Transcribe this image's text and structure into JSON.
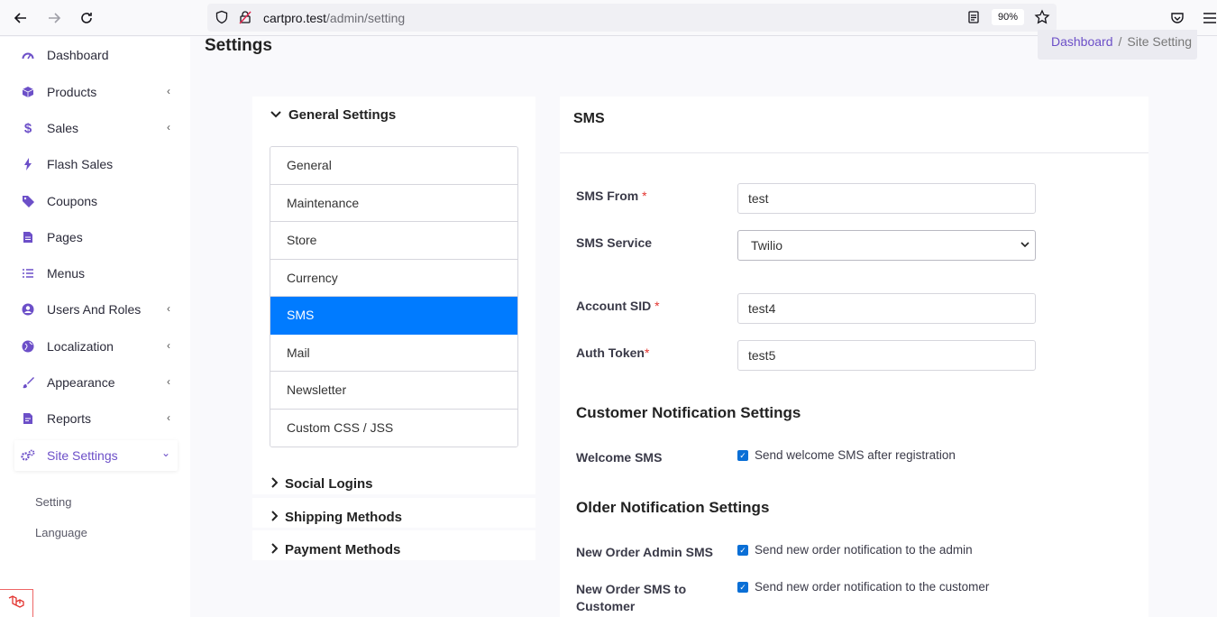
{
  "browser": {
    "url_host": "cartpro.test",
    "url_path": "/admin/setting",
    "zoom": "90%"
  },
  "sidebar": {
    "items": [
      {
        "label": "Dashboard",
        "icon": "dashboard-gauge-icon",
        "chevron": ""
      },
      {
        "label": "Products",
        "icon": "box-icon",
        "chevron": "‹"
      },
      {
        "label": "Sales",
        "icon": "dollar-icon",
        "chevron": "‹"
      },
      {
        "label": "Flash Sales",
        "icon": "bolt-icon",
        "chevron": ""
      },
      {
        "label": "Coupons",
        "icon": "tags-icon",
        "chevron": ""
      },
      {
        "label": "Pages",
        "icon": "file-icon",
        "chevron": ""
      },
      {
        "label": "Menus",
        "icon": "list-icon",
        "chevron": ""
      },
      {
        "label": "Users And Roles",
        "icon": "user-circle-icon",
        "chevron": "‹"
      },
      {
        "label": "Localization",
        "icon": "globe-icon",
        "chevron": "‹"
      },
      {
        "label": "Appearance",
        "icon": "brush-icon",
        "chevron": "‹"
      },
      {
        "label": "Reports",
        "icon": "report-icon",
        "chevron": "‹"
      },
      {
        "label": "Site Settings",
        "icon": "cogs-icon",
        "chevron": "⌄"
      }
    ],
    "submenu": [
      "Setting",
      "Language"
    ]
  },
  "page": {
    "title": "Settings",
    "breadcrumb": {
      "link": "Dashboard",
      "separator": "/",
      "current": "Site Setting"
    }
  },
  "settings_nav": {
    "general_heading": "General Settings",
    "items": [
      "General",
      "Maintenance",
      "Store",
      "Currency",
      "SMS",
      "Mail",
      "Newsletter",
      "Custom CSS / JSS"
    ],
    "active_item": "SMS",
    "collapsed_sections": [
      "Social Logins",
      "Shipping Methods",
      "Payment Methods"
    ]
  },
  "sms_form": {
    "title": "SMS",
    "sms_from": {
      "label": "SMS From",
      "required": "*",
      "value": "test"
    },
    "sms_service": {
      "label": "SMS Service",
      "value": "Twilio"
    },
    "account_sid": {
      "label": "Account SID",
      "required": "*",
      "value": "test4"
    },
    "auth_token": {
      "label": "Auth Token",
      "required": "*",
      "value": "test5"
    },
    "customer_section": "Customer Notification Settings",
    "welcome_sms": {
      "label": "Welcome SMS",
      "text": "Send welcome SMS after registration",
      "checked": true
    },
    "order_section": "Older Notification Settings",
    "new_order_admin": {
      "label": "New Order Admin SMS",
      "text": "Send new order notification to the admin",
      "checked": true
    },
    "new_order_customer": {
      "label_line1": "New Order SMS to",
      "label_line2": "Customer",
      "text": "Send new order notification to the customer",
      "checked": true
    }
  },
  "colors": {
    "accent": "#6c4fc8",
    "active_item": "#007bff",
    "checkbox": "#0a6fd6",
    "required": "#e3342f"
  }
}
